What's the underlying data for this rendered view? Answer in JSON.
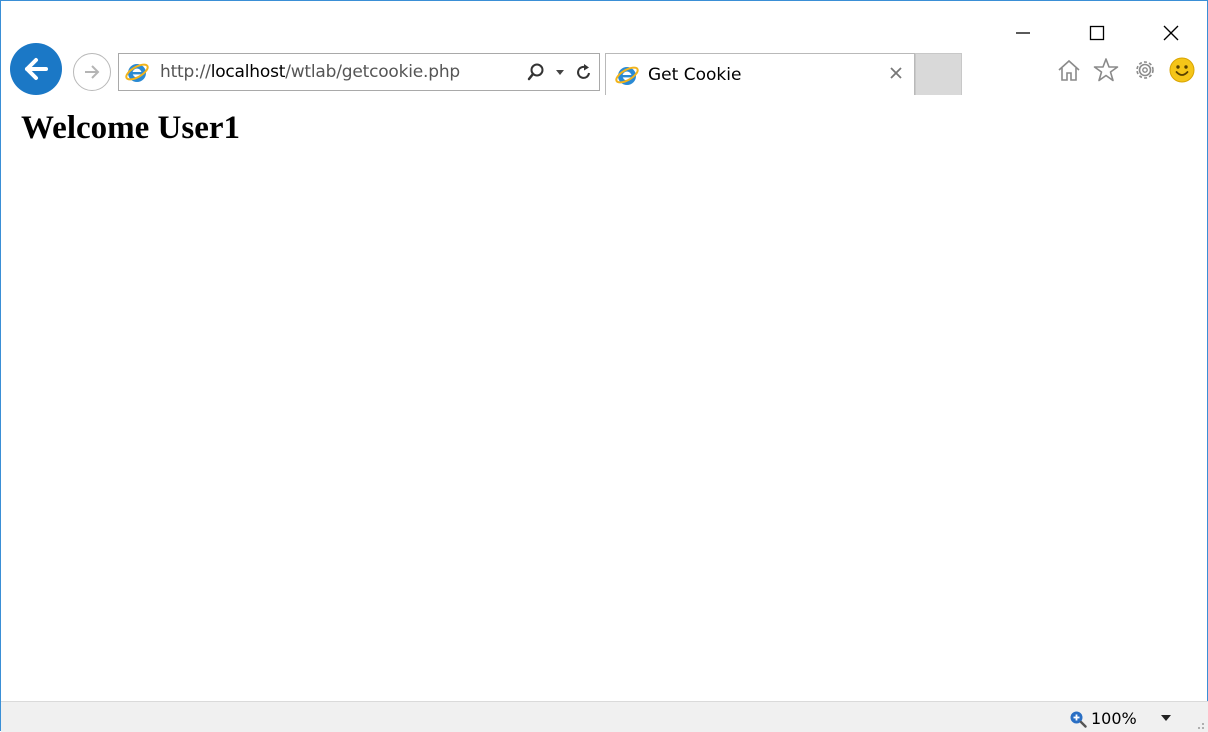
{
  "window": {
    "caption_buttons": [
      "minimize",
      "maximize",
      "close"
    ]
  },
  "address_bar": {
    "url_scheme": "http://",
    "url_host": "localhost",
    "url_path": "/wtlab/getcookie.php"
  },
  "tab": {
    "title": "Get Cookie"
  },
  "page": {
    "heading": "Welcome User1"
  },
  "status_bar": {
    "zoom": "100%"
  },
  "colors": {
    "accent": "#1b78c6",
    "ie_icon": "#2a8ad4",
    "ie_ring": "#f2b41c",
    "smiley": "#f5c518"
  },
  "icons": [
    "back-arrow-icon",
    "forward-arrow-icon",
    "ie-logo-icon",
    "search-icon",
    "dropdown-icon",
    "refresh-icon",
    "close-tab-icon",
    "home-icon",
    "favorites-star-icon",
    "settings-gear-icon",
    "feedback-smiley-icon",
    "zoom-icon"
  ]
}
